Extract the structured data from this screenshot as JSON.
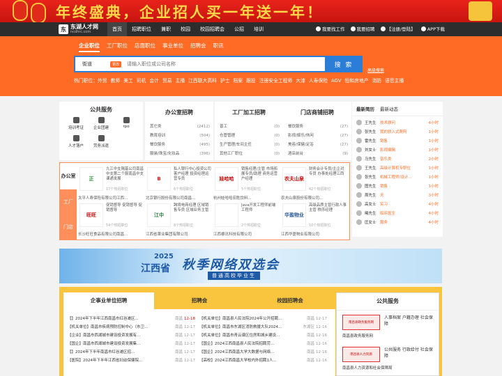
{
  "banner": {
    "text": "年终盛典，企业招人买一年送一年！"
  },
  "logo": {
    "name": "东湖人才网",
    "domain": "ncdhrc.com",
    "mark": "东"
  },
  "nav": {
    "items": [
      "首页",
      "招聘职位",
      "兼职",
      "校园",
      "校园招聘会",
      "公招",
      "培训"
    ],
    "right": [
      "我要找工作",
      "我要招聘",
      "【注册/登陆】",
      "APP下载"
    ]
  },
  "search": {
    "tabs": [
      "企业职位",
      "工厂职位",
      "店面职位",
      "事业单位",
      "招聘会",
      "职讯"
    ],
    "city": "街道",
    "change": "更改",
    "placeholder": "请输入职位或公司名称",
    "button": "搜 索",
    "advanced": "高级搜索",
    "hot_label": "热门职位：",
    "hot": [
      "外贸",
      "教师",
      "美工",
      "司机",
      "会计",
      "贸易",
      "主播",
      "江西联大高科",
      "护士",
      "档案",
      "跟投",
      "注册安全工程师",
      "大漆",
      "人寿保险",
      "AGV",
      "恒和房地产",
      "消防",
      "语音主播"
    ]
  },
  "services": {
    "title": "公共服务",
    "items": [
      "培训考证",
      "企业团建",
      "rpo",
      "人才落户",
      "劳务派遣"
    ]
  },
  "cats": [
    {
      "title": "办公室招聘",
      "rows": [
        [
          "其它类",
          "(2412)"
        ],
        [
          "教育培训",
          "(504)"
        ],
        [
          "餐饮服务",
          "(495)"
        ],
        [
          "服装/珠宝/化妆品",
          "(396)"
        ]
      ]
    },
    {
      "title": "工厂加工招聘",
      "rows": [
        [
          "普工",
          "(0)"
        ],
        [
          "仓管管理",
          "(0)"
        ],
        [
          "生产管理/车间主任",
          "(0)"
        ],
        [
          "其他工厂职位",
          "(0)"
        ]
      ]
    },
    {
      "title": "门店商铺招聘",
      "rows": [
        [
          "餐饮服务",
          "(27)"
        ],
        [
          "影视/娱乐/休闲",
          "(27)"
        ],
        [
          "美容/保健/足浴",
          "(27)"
        ],
        [
          "酒店前台",
          "(9)"
        ]
      ]
    }
  ],
  "news": {
    "tabs": [
      "最新简历",
      "最新动态"
    ],
    "rows": [
      [
        "王先生",
        "技术顾问",
        "4小时"
      ],
      [
        "张先生",
        "我的骄入式爬阿",
        "1小时"
      ],
      [
        "雷先生",
        "销售",
        "1小时"
      ],
      [
        "刘女士",
        "影视编辑",
        "1小时"
      ],
      [
        "马先生",
        "音乐类",
        "2小时"
      ],
      [
        "王先生",
        "高级计算机专职位",
        "1小时"
      ],
      [
        "张先生",
        "机械工程师/设计...",
        "1小时"
      ],
      [
        "图先生",
        "销售",
        "1小时"
      ],
      [
        "周先生",
        "无",
        "3小时"
      ],
      [
        "高女士",
        "实习",
        "4小时"
      ],
      [
        "曦先生",
        "临床医生",
        "4小时"
      ],
      [
        "匡女士",
        "服务",
        "4小时"
      ]
    ]
  },
  "companies": {
    "side": [
      "办公室",
      "工厂",
      "门店"
    ],
    "cells": [
      {
        "logo": "正",
        "color": "#2a8a3a",
        "jobs": "九江中支隔基公司南昌中支第二个服南昌中支课通发展",
        "count": "17个热招职位",
        "name": "太平人寿保险有限公司江西..."
      },
      {
        "logo": "B",
        "color": "#d22",
        "jobs": "私人银行中心投资公司客户经理 投资经理运营专员",
        "count": "6个热招职位",
        "name": "北京银行股份有限公司南昌..."
      },
      {
        "logo": "娃哈哈",
        "color": "#c00",
        "jobs": "销售经理/主管 市场拓展专员/助理 商务运营户经理",
        "count": "5个热招职位",
        "name": "杭州娃哈哈宏胜饮料..."
      },
      {
        "logo": "农夫山泉",
        "color": "#c00",
        "jobs": "财务会计专员/主企对专员 办事处经理江西",
        "count": "42个热招职位",
        "name": "农夫山泉股份有限公司..."
      },
      {
        "logo": "旺旺",
        "color": "#c00",
        "jobs": "促销督导 促销督导 促销督导",
        "count": "54个热招职位",
        "name": "长沙旺旺食品有限公司南昌..."
      },
      {
        "logo": "江中",
        "color": "#2a7a3a",
        "jobs": "跨境电商经理 区域销售专员 区域业务主管",
        "count": "8个热招职位",
        "name": "江西省萧业集团有限公司"
      },
      {
        "logo": "",
        "color": "#888",
        "jobs": "Java开发工程师前端工程师",
        "count": "2个热招职位",
        "name": "江西睿讯科技有限公司"
      },
      {
        "logo": "华盈物业",
        "color": "#2a5a9a",
        "jobs": "高级品质主管行政人事主管 秩序经理",
        "count": "10个热招职位",
        "name": "江西华盈物业有限公司"
      }
    ]
  },
  "ad": {
    "year": "2025",
    "province": "江西省",
    "main": "秋季网络双选会",
    "sub": "普通高校毕业生"
  },
  "bottom": {
    "tabs": [
      "企事业单位招聘",
      "招聘会",
      "校园招聘会"
    ],
    "left": [
      [
        "【】2024年下半年江西南昌市红谷滩区...",
        "南昌",
        "12-18",
        true
      ],
      [
        "【机关单位】南昌市疾病预防控制中心（市卫...",
        "南昌",
        "12-17",
        false
      ],
      [
        "【企业】南昌市西湖城市建设投资发展有...",
        "南昌",
        "12-17",
        false
      ],
      [
        "【国企】南昌市西湖城市建设投资发展集...",
        "南昌",
        "12-17",
        false
      ],
      [
        "【】2024年下半年南昌市红谷滩区招...",
        "南昌",
        "12-17",
        false
      ],
      [
        "【医院】2024年下半年江西省妇幼保健院...",
        "南昌",
        "12-17",
        false
      ]
    ],
    "right": [
      [
        "【机关单位】南昌县人民法院2024年公开招聘...",
        "南昌",
        "12-17",
        false
      ],
      [
        "【机关单位】南昌市东湖区消防救援大队2024...",
        "东湖区",
        "12-16",
        false
      ],
      [
        "【机关单位】南昌市青云谱区住房和城乡建设...",
        "南昌",
        "12-16",
        false
      ],
      [
        "【国企】2024江西南昌县人民法院招聘劳...",
        "南昌",
        "12-16",
        false
      ],
      [
        "【国企】2024江西南昌大学大数据与网络...",
        "南昌",
        "12-16",
        false
      ],
      [
        "【高校】2024江西南昌大学校内外招聘1人...",
        "南昌",
        "12-16",
        false
      ]
    ]
  },
  "public": {
    "title": "公共服务",
    "items": [
      {
        "emblem": "南昌县政务服务网",
        "label": "人事档案 户籍办理 社会保障",
        "name": "南昌县政务服务网"
      },
      {
        "emblem": "南昌县人力资源",
        "label": "公共服务 行政给付 社会保障",
        "name": "南昌县人力资源和社会保障局"
      }
    ]
  },
  "colors": {
    "accent": "#ff6b24",
    "blue": "#2b7ed8",
    "nav": "#2d2d2d",
    "banner": "#d81c14",
    "gold": "#f9c53f"
  }
}
